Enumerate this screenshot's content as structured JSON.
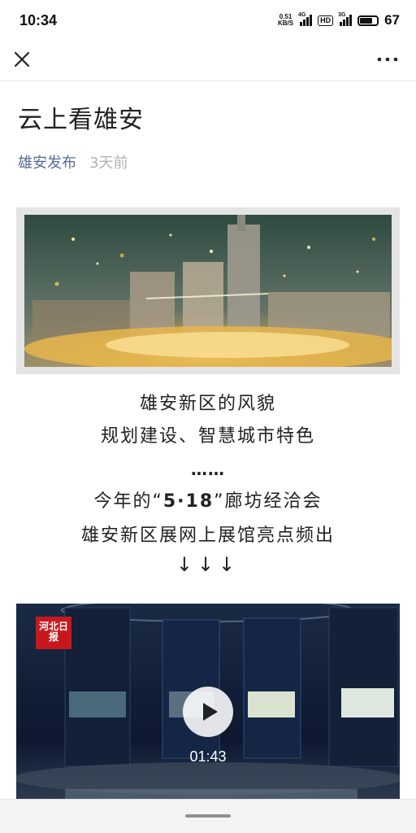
{
  "status_bar": {
    "time": "10:34",
    "net_speed_value": "0.51",
    "net_speed_unit": "KB/S",
    "network_1": "4G",
    "hd_badge": "HD",
    "network_2": "3G",
    "battery_level": "67"
  },
  "nav": {
    "close_icon": "close-icon",
    "more_icon": "more-icon"
  },
  "article": {
    "title": "云上看雄安",
    "author": "雄安发布",
    "time": "3天前",
    "line_1": "雄安新区的风貌",
    "line_2": "规划建设、智慧城市特色",
    "line_3": "……",
    "line_4_pre": "今年的“",
    "line_4_num": "5·18",
    "line_4_post": "”廊坊经洽会",
    "line_5": "雄安新区展网上展馆亮点频出",
    "line_6": "↓↓↓"
  },
  "video": {
    "duration": "01:43",
    "logo_text": "河北日报",
    "play_icon": "play-icon"
  },
  "colors": {
    "link": "#576b95",
    "meta_gray": "#b2b2b2",
    "logo_red": "#c8181e"
  }
}
